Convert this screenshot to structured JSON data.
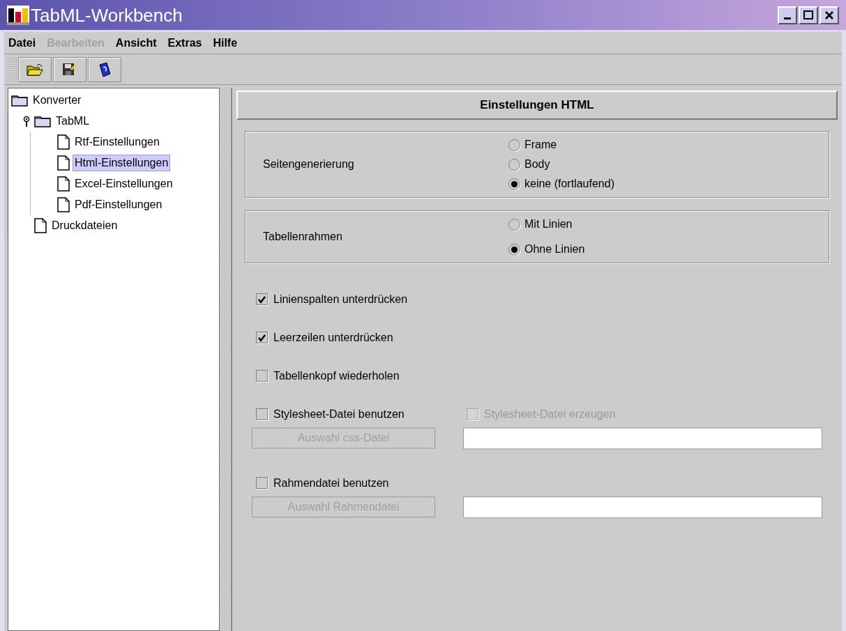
{
  "window": {
    "title": "TabML-Workbench"
  },
  "menu": [
    {
      "label": "Datei",
      "disabled": false
    },
    {
      "label": "Bearbeiten",
      "disabled": true
    },
    {
      "label": "Ansicht",
      "disabled": false
    },
    {
      "label": "Extras",
      "disabled": false
    },
    {
      "label": "Hilfe",
      "disabled": false
    }
  ],
  "tree": [
    {
      "label": "Konverter",
      "kind": "folder",
      "selected": false,
      "children": [
        {
          "label": "TabML",
          "kind": "folder",
          "selected": false,
          "expanded": true,
          "children": [
            {
              "label": "Rtf-Einstellungen",
              "kind": "file",
              "selected": false
            },
            {
              "label": "Html-Einstellungen",
              "kind": "file",
              "selected": true
            },
            {
              "label": "Excel-Einstellungen",
              "kind": "file",
              "selected": false
            },
            {
              "label": "Pdf-Einstellungen",
              "kind": "file",
              "selected": false
            }
          ]
        },
        {
          "label": "Druckdateien",
          "kind": "file",
          "selected": false
        }
      ]
    }
  ],
  "panel": {
    "title": "Einstellungen HTML",
    "groups": [
      {
        "label": "Seitengenerierung",
        "options": [
          {
            "label": "Frame",
            "selected": false
          },
          {
            "label": "Body",
            "selected": false
          },
          {
            "label": "keine (fortlaufend)",
            "selected": true
          }
        ]
      },
      {
        "label": "Tabellenrahmen",
        "options": [
          {
            "label": "Mit Linien",
            "selected": false
          },
          {
            "label": "Ohne Linien",
            "selected": true
          }
        ]
      }
    ],
    "rows": [
      {
        "kind": "checkbox",
        "label": "Linienspalten unterdrücken",
        "checked": true,
        "disabled": false
      },
      {
        "kind": "checkbox",
        "label": "Leerzeilen unterdrücken",
        "checked": true,
        "disabled": false
      },
      {
        "kind": "checkbox",
        "label": "Tabellenkopf wiederholen",
        "checked": false,
        "disabled": false
      },
      {
        "kind": "checkbox",
        "label": "Stylesheet-Datei benutzen",
        "checked": false,
        "disabled": false,
        "secondary": {
          "label": "Stylesheet-Datei erzeugen",
          "checked": false,
          "disabled": true
        }
      },
      {
        "kind": "file",
        "button": "Auswahl css-Datei",
        "disabled": true
      },
      {
        "kind": "checkbox",
        "label": "Rahmendatei benutzen",
        "checked": false,
        "disabled": false
      },
      {
        "kind": "file",
        "button": "Auswahl Rahmendatei",
        "disabled": true
      }
    ]
  }
}
